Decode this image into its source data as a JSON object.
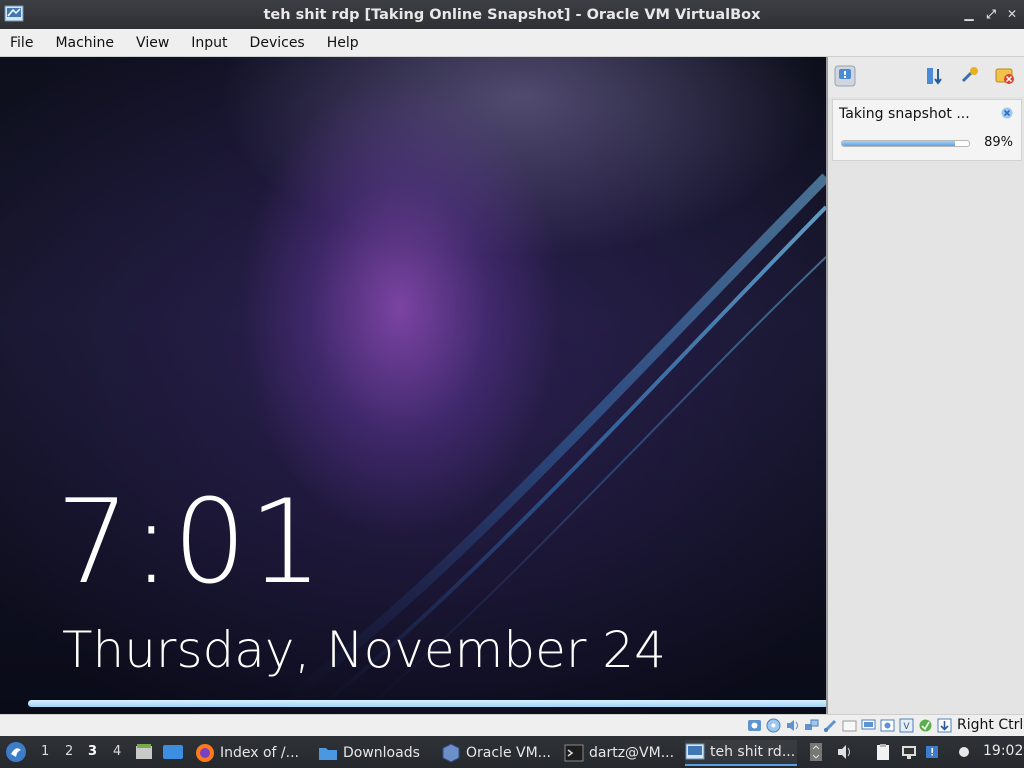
{
  "window": {
    "title": "teh shit rdp [Taking Online Snapshot] - Oracle VM VirtualBox",
    "controls": [
      "minimize",
      "restore",
      "close"
    ]
  },
  "menubar": {
    "items": [
      "File",
      "Machine",
      "View",
      "Input",
      "Devices",
      "Help"
    ]
  },
  "vm_screen": {
    "time": "7:01",
    "date": "Thursday, November 24"
  },
  "notification_center": {
    "toolbar_icons": [
      "notification-center-icon",
      "sort-icon",
      "keep-icon",
      "remove-all-icon"
    ],
    "task_label": "Taking snapshot ...",
    "progress_text": "89%",
    "progress_fraction": 0.89
  },
  "statusbar": {
    "icons": [
      "hard-disk-icon",
      "optical-disk-icon",
      "audio-icon",
      "network-icon",
      "usb-icon",
      "shared-folders-icon",
      "display-icon",
      "recording-icon",
      "vt-x-icon",
      "guest-additions-icon",
      "mouse-integration-icon",
      "keyboard-icon"
    ],
    "host_key": "Right Ctrl"
  },
  "taskbar": {
    "workspaces": [
      "1",
      "2",
      "3",
      "4"
    ],
    "active_workspace": "3",
    "tasks": [
      {
        "label": "Index of /...",
        "icon": "firefox-icon"
      },
      {
        "label": "Downloads",
        "icon": "folder-icon"
      },
      {
        "label": "Oracle VM...",
        "icon": "virtualbox-icon"
      },
      {
        "label": "dartz@VM...",
        "icon": "terminal-icon"
      },
      {
        "label": "teh shit rd...",
        "icon": "vm-window-icon"
      }
    ],
    "clock": "19:02"
  },
  "colors": {
    "titlebar": "#2e3034",
    "menubar": "#efefef",
    "progress_fill": "#5da3e3",
    "taskbar": "#25282c",
    "accent": "#5aa0e8"
  }
}
